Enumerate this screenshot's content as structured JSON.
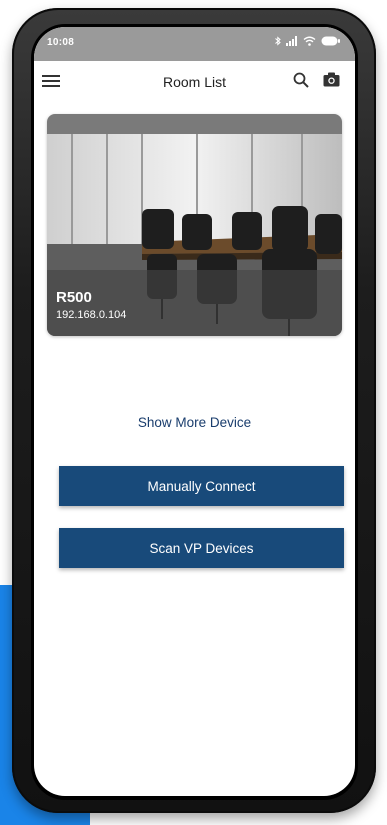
{
  "status_bar": {
    "time": "10:08",
    "icons": [
      "bluetooth-icon",
      "signal-icon",
      "wifi-icon",
      "battery-icon"
    ]
  },
  "header": {
    "title": "Room List",
    "menu_icon": "hamburger-menu-icon",
    "search_icon": "search-icon",
    "camera_icon": "camera-icon"
  },
  "rooms": [
    {
      "name": "R500",
      "ip": "192.168.0.104"
    }
  ],
  "show_more_label": "Show More Device",
  "buttons": {
    "manual_connect": "Manually Connect",
    "scan_vp": "Scan VP Devices"
  },
  "colors": {
    "primary_button": "#184a7a",
    "link_text": "#1a3d6d",
    "status_bar": "#9a9a9a",
    "accent_background": "#1a84e8"
  }
}
